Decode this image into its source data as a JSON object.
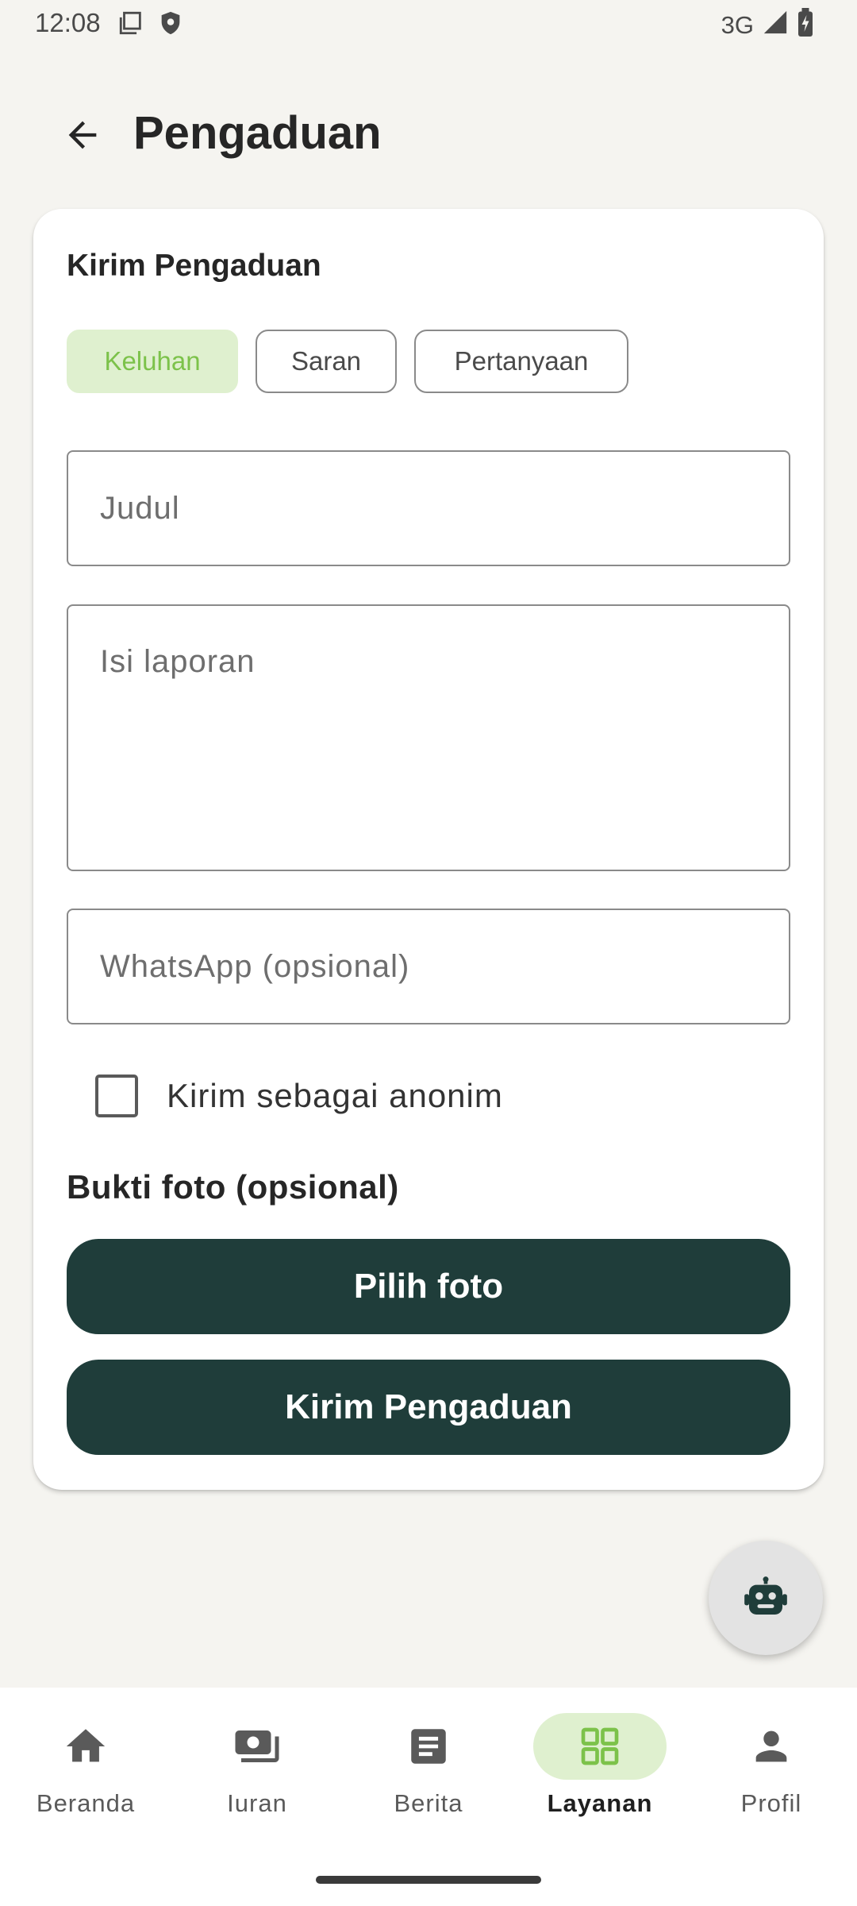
{
  "status_bar": {
    "time": "12:08",
    "network": "3G"
  },
  "header": {
    "title": "Pengaduan"
  },
  "form": {
    "title": "Kirim Pengaduan",
    "categories": [
      {
        "label": "Keluhan",
        "selected": true
      },
      {
        "label": "Saran",
        "selected": false
      },
      {
        "label": "Pertanyaan",
        "selected": false
      }
    ],
    "judul_placeholder": "Judul",
    "isi_placeholder": "Isi laporan",
    "whatsapp_placeholder": "WhatsApp (opsional)",
    "anonymous_label": "Kirim sebagai anonim",
    "anonymous_checked": false,
    "photo_section_label": "Bukti foto (opsional)",
    "choose_photo_label": "Pilih foto",
    "submit_label": "Kirim Pengaduan"
  },
  "fab": {
    "icon": "robot-icon"
  },
  "bottom_nav": {
    "items": [
      {
        "label": "Beranda",
        "icon": "home-icon",
        "active": false
      },
      {
        "label": "Iuran",
        "icon": "payments-icon",
        "active": false
      },
      {
        "label": "Berita",
        "icon": "article-icon",
        "active": false
      },
      {
        "label": "Layanan",
        "icon": "grid-icon",
        "active": true
      },
      {
        "label": "Profil",
        "icon": "person-icon",
        "active": false
      }
    ]
  },
  "colors": {
    "accent_green": "#7cc24a",
    "chip_selected_bg": "#dff0cf",
    "button_dark": "#1f3d3a",
    "background": "#f5f4f0"
  }
}
